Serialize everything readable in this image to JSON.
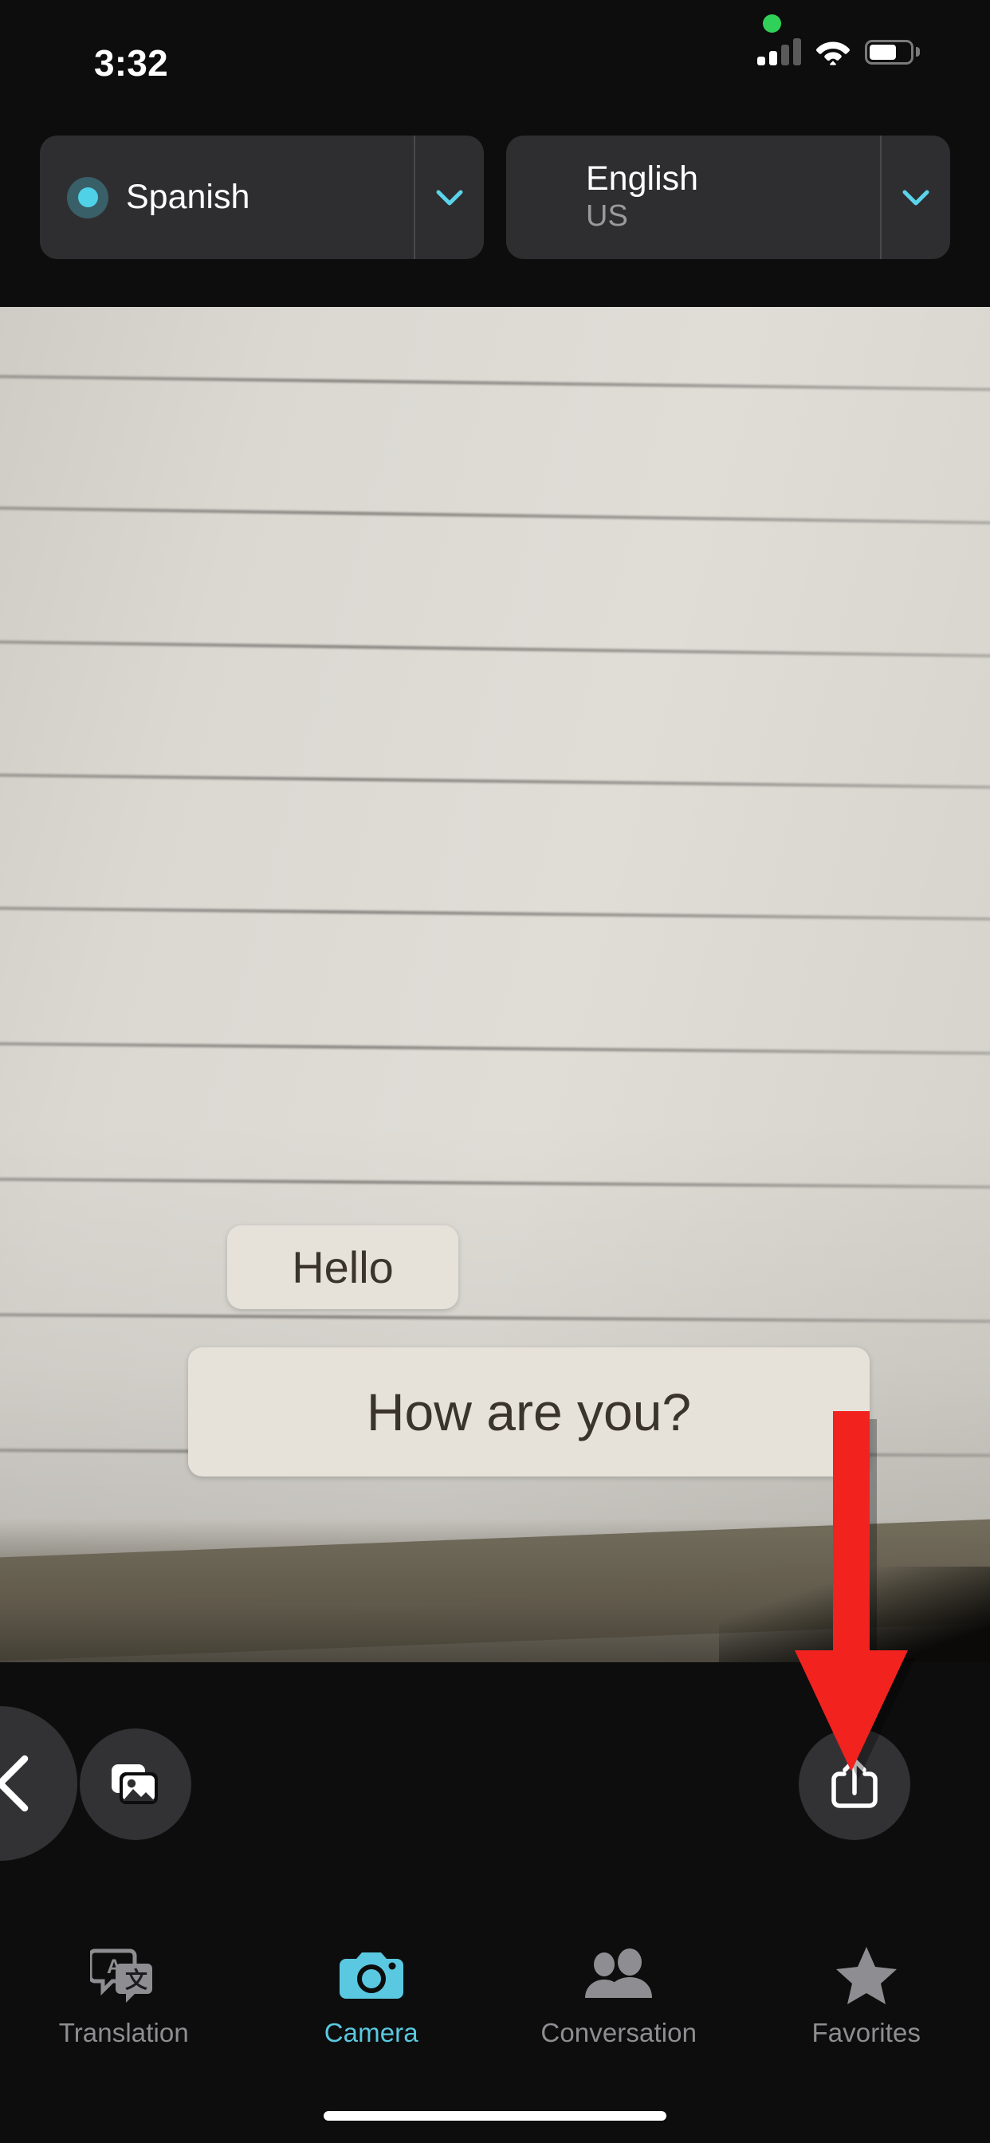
{
  "status_bar": {
    "time": "3:32",
    "recording_indicator": "green-dot",
    "cellular_icon": "cellular-signal-icon",
    "cellular_bars_filled": 2,
    "cellular_bars_total": 4,
    "wifi_icon": "wifi-icon",
    "battery_icon": "battery-icon",
    "battery_level_percent": 68
  },
  "language_bar": {
    "source": {
      "name": "Spanish",
      "sublabel": "",
      "mic_indicator": "active-listening-dot",
      "chevron_icon": "chevron-down-icon"
    },
    "target": {
      "name": "English",
      "sublabel": "US",
      "chevron_icon": "chevron-down-icon"
    }
  },
  "viewfinder": {
    "scene_description": "lined notebook paper",
    "overlays": [
      {
        "text": "Hello"
      },
      {
        "text": "How are you?"
      }
    ],
    "annotation": {
      "type": "arrow",
      "direction": "down",
      "color": "#f2221f",
      "points_to": "share-button"
    }
  },
  "controls": {
    "library_button": {
      "icon": "photo-library-icon",
      "label": ""
    },
    "close_button": {
      "icon": "close-x-icon",
      "label": ""
    },
    "share_button": {
      "icon": "share-icon",
      "label": ""
    }
  },
  "tab_bar": {
    "active": "Camera",
    "active_color": "#5ac8e0",
    "inactive_color": "#8e8e92",
    "tabs": [
      {
        "label": "Translation",
        "icon": "translation-bubbles-icon",
        "active": false
      },
      {
        "label": "Camera",
        "icon": "camera-icon",
        "active": true
      },
      {
        "label": "Conversation",
        "icon": "two-people-icon",
        "active": false
      },
      {
        "label": "Favorites",
        "icon": "star-icon",
        "active": false
      }
    ]
  },
  "home_indicator": {
    "present": true
  }
}
